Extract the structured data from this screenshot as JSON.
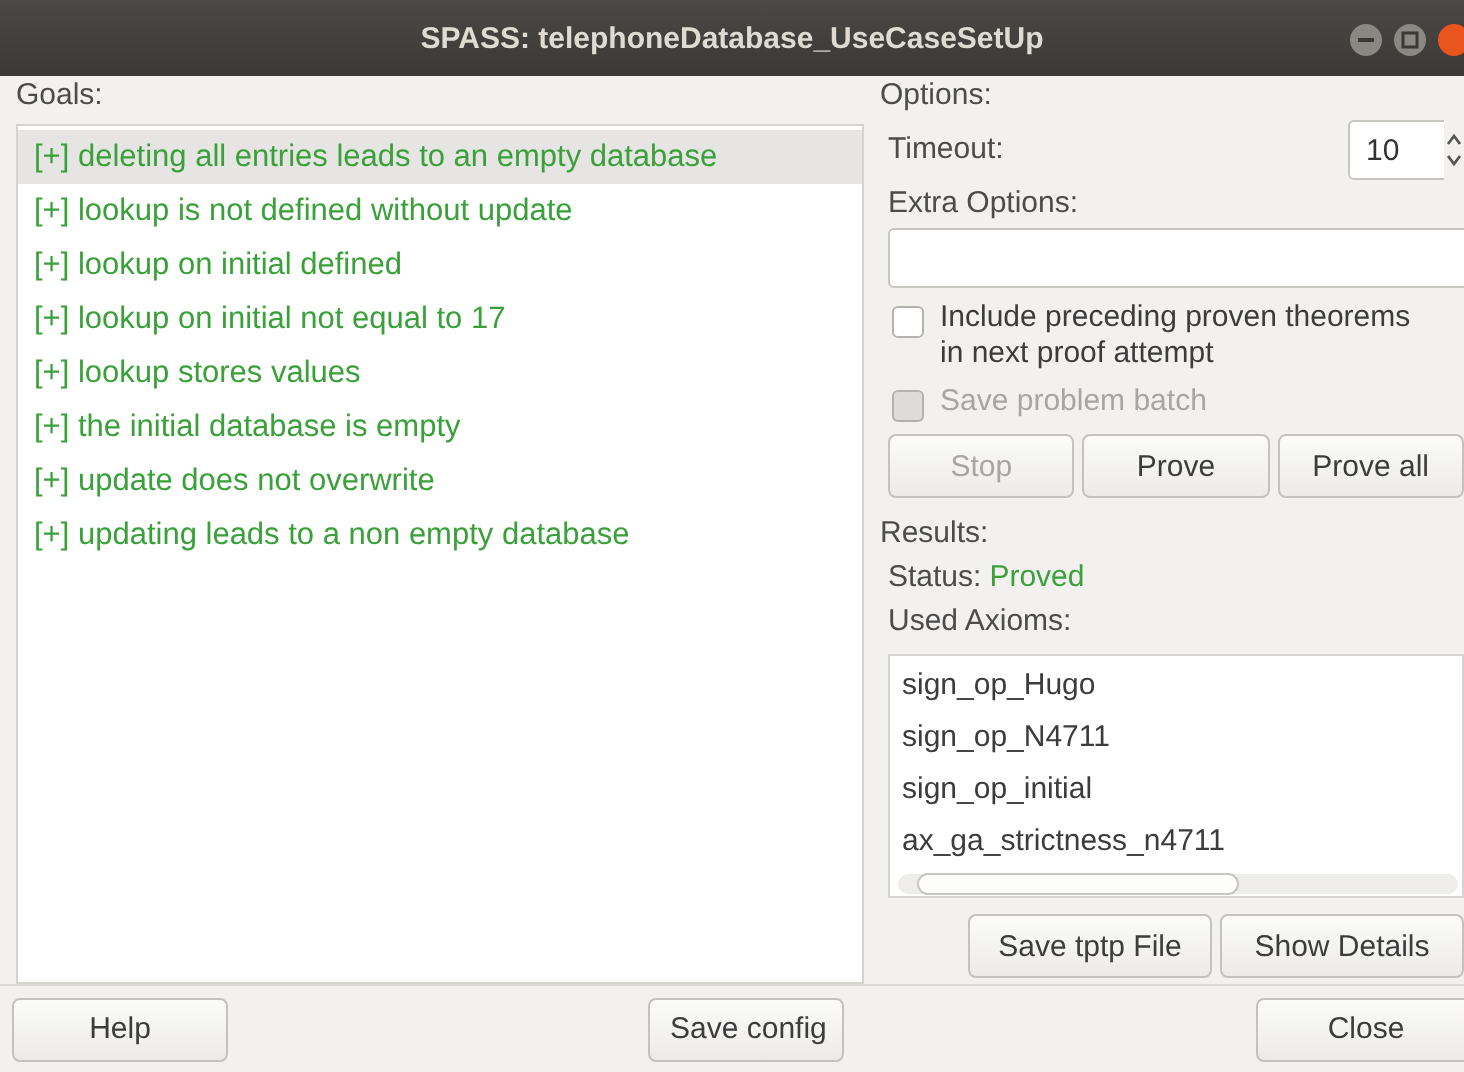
{
  "window": {
    "title": "SPASS: telephoneDatabase_UseCaseSetUp"
  },
  "goals": {
    "label": "Goals:",
    "items": [
      {
        "text": "[+] deleting all entries leads to an empty database",
        "selected": true
      },
      {
        "text": "[+] lookup is not defined without update",
        "selected": false
      },
      {
        "text": "[+] lookup on initial defined",
        "selected": false
      },
      {
        "text": "[+] lookup on initial not equal to 17",
        "selected": false
      },
      {
        "text": "[+] lookup stores values",
        "selected": false
      },
      {
        "text": "[+] the initial database is empty",
        "selected": false
      },
      {
        "text": "[+] update does not overwrite",
        "selected": false
      },
      {
        "text": "[+] updating leads to a non empty database",
        "selected": false
      }
    ]
  },
  "options": {
    "label": "Options:",
    "timeout_label": "Timeout:",
    "timeout_value": "10",
    "extra_label": "Extra Options:",
    "checkboxes": [
      {
        "label": "Include preceding proven theorems in next proof attempt",
        "checked": false,
        "disabled": false
      },
      {
        "label": "Save problem batch",
        "checked": false,
        "disabled": true
      }
    ],
    "buttons": [
      {
        "label": "Stop",
        "disabled": true
      },
      {
        "label": "Prove",
        "disabled": false
      },
      {
        "label": "Prove all",
        "disabled": false
      }
    ]
  },
  "results": {
    "label": "Results:",
    "status_label": "Status:",
    "status_value": "Proved",
    "axioms_label": "Used Axioms:",
    "axioms": [
      "sign_op_Hugo",
      "sign_op_N4711",
      "sign_op_initial",
      "ax_ga_strictness_n4711"
    ],
    "buttons": [
      "Save tptp File",
      "Show Details"
    ]
  },
  "footer": {
    "left_buttons": [
      "Help",
      "Save config"
    ],
    "right_buttons": [
      "Close"
    ]
  }
}
